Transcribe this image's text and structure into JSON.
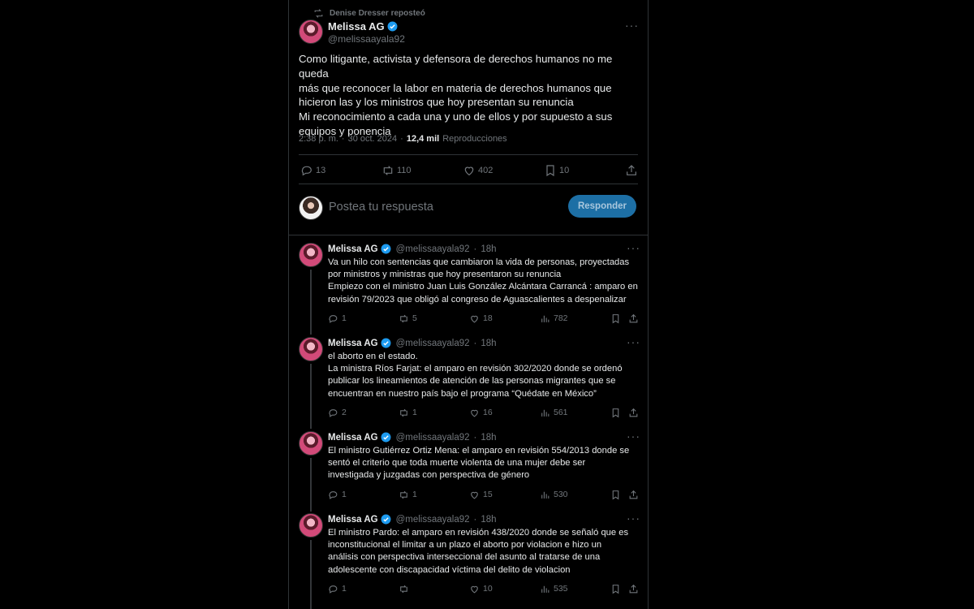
{
  "colors": {
    "background": "#000000",
    "text": "#e7e9ea",
    "muted": "#71767b",
    "border": "#2f3336",
    "accent": "#1d9bf0"
  },
  "repost": {
    "label": "Denise Dresser reposteó",
    "icon": "repost-icon"
  },
  "main_tweet": {
    "author": "Melissa AG",
    "handle": "@melissaayala92",
    "text": "Como litigante, activista y defensora de derechos humanos no me queda\nmás que reconocer la labor en materia de derechos humanos que\nhicieron las y los ministros que hoy presentan su renuncia\nMi reconocimiento a cada una y uno de ellos y por supuesto a sus\nequipos y ponencia",
    "time": "2:38 p. m.",
    "date": "30 oct. 2024",
    "sep": "·",
    "views": "12,4 mil",
    "views_label": "Reproducciones",
    "stats": {
      "replies": "13",
      "reposts": "110",
      "likes": "402",
      "bookmarks": "10"
    }
  },
  "compose": {
    "placeholder": "Postea tu respuesta",
    "button": "Responder"
  },
  "replies": [
    {
      "author": "Melissa AG",
      "handle": "@melissaayala92",
      "time": "18h",
      "sep": "·",
      "text": "Va un hilo con sentencias que cambiaron la vida de personas, proyectadas\npor ministros y ministras que hoy presentaron su renuncia\nEmpiezo con el ministro Juan Luis González Alcántara Carrancá : amparo en\nrevisión 79/2023 que obligó al congreso de Aguascalientes a despenalizar",
      "replies": "1",
      "reposts": "5",
      "likes": "18",
      "views": "782"
    },
    {
      "author": "Melissa AG",
      "handle": "@melissaayala92",
      "time": "18h",
      "sep": "·",
      "text": "el aborto en el estado.\nLa ministra Ríos Farjat: el amparo en revisión 302/2020 donde se ordenó\npublicar los lineamientos de atención de las personas migrantes que se\nencuentran en nuestro país bajo el programa “Quédate en México”",
      "replies": "2",
      "reposts": "1",
      "likes": "16",
      "views": "561"
    },
    {
      "author": "Melissa AG",
      "handle": "@melissaayala92",
      "time": "18h",
      "sep": "·",
      "text": "El ministro Gutiérrez Ortiz Mena: el amparo en revisión 554/2013 donde se\nsentó el criterio que toda muerte violenta de una mujer debe ser\ninvestigada y juzgadas con perspectiva de género",
      "replies": "1",
      "reposts": "1",
      "likes": "15",
      "views": "530"
    },
    {
      "author": "Melissa AG",
      "handle": "@melissaayala92",
      "time": "18h",
      "sep": "·",
      "text": "El ministro Pardo: el amparo en revisión 438/2020 donde se señaló que es\ninconstitucional el limitar a un plazo el aborto por violacion e hizo un\nanálisis con perspectiva interseccional del asunto al tratarse de una\nadolescente con discapacidad víctima del delito de violacion",
      "replies": "1",
      "reposts": "",
      "likes": "10",
      "views": "535"
    }
  ]
}
